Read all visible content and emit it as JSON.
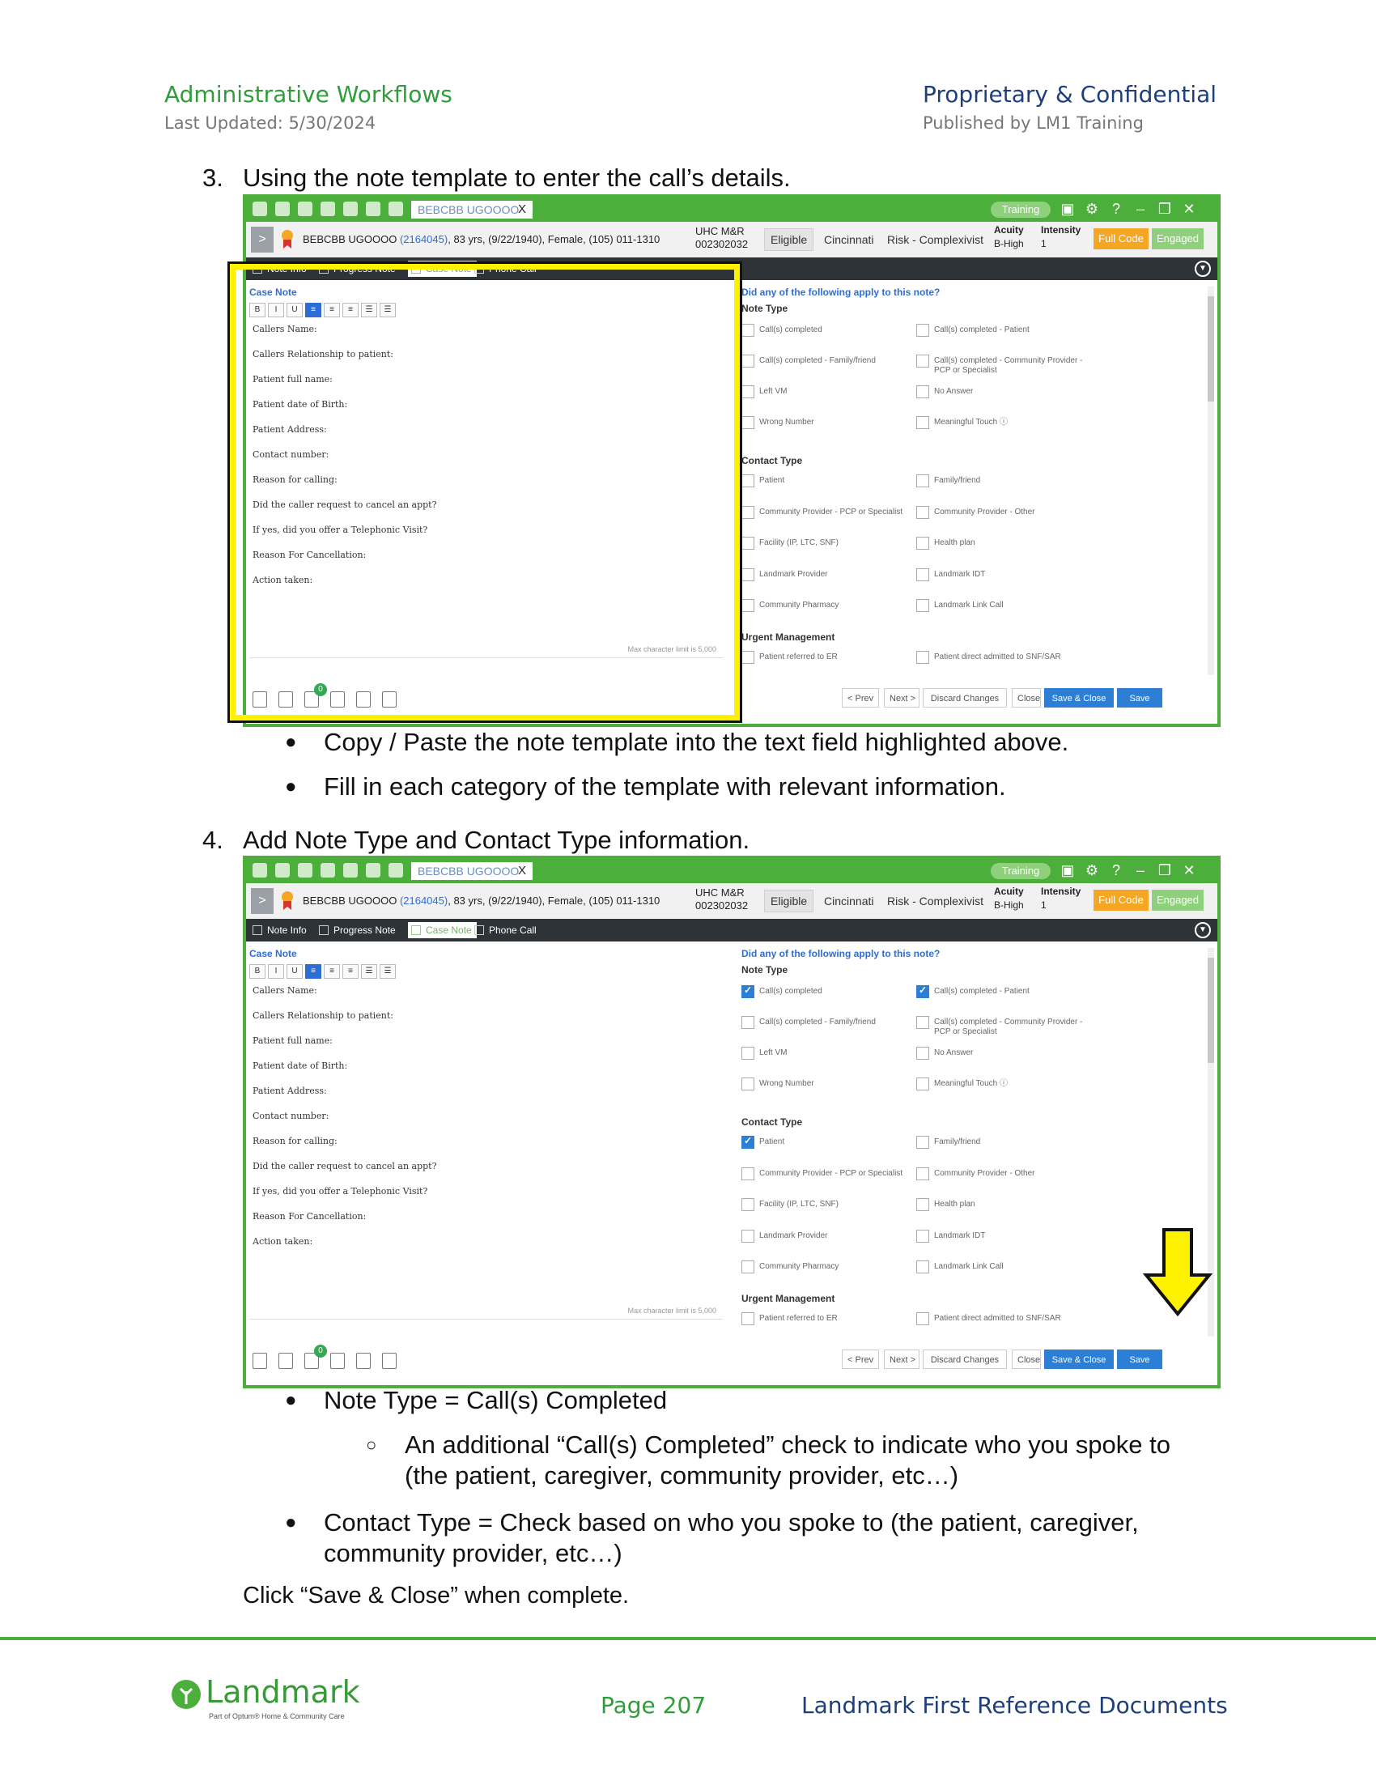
{
  "header": {
    "left_title": "Administrative Workflows",
    "left_sub": "Last Updated: 5/30/2024",
    "right_title": "Proprietary & Confidential",
    "right_sub": "Published by LM1 Training"
  },
  "step3": {
    "num": "3.",
    "text": "Using the note template to enter the call’s details.",
    "bullets": [
      "Copy / Paste the note template into the text field highlighted above.",
      "Fill in each category of the template with relevant information."
    ]
  },
  "step4": {
    "num": "4.",
    "text": "Add Note Type and Contact Type information.",
    "bullet1": "Note Type = Call(s) Completed",
    "sub_bullet": "An additional “Call(s) Completed” check to indicate who you spoke to (the patient, caregiver, community provider, etc…)",
    "bullet2": "Contact Type = Check based on who you spoke to (the patient,  caregiver, community provider, etc…)",
    "closing": "Click “Save & Close” when complete."
  },
  "app": {
    "tab_label": "BEBCBB UGOOOO",
    "tab_close": "X",
    "training": "Training",
    "patient_name": "BEBCBB UGOOOO",
    "patient_id": "(2164045)",
    "patient_info": ", 83 yrs, (9/22/1940), Female, (105) 011-1310",
    "plan_line1": "UHC M&R",
    "plan_line2": "002302032",
    "eligible": "Eligible",
    "city": "Cincinnati",
    "risk": "Risk - Complexivist",
    "acuity_label": "Acuity",
    "acuity_value": "B-High",
    "intensity_label": "Intensity",
    "intensity_value": "1",
    "full_code": "Full Code",
    "engaged": "Engaged",
    "nav_tabs": [
      "Note Info",
      "Progress Note",
      "Case Note",
      "Phone Call"
    ],
    "editor_title": "Case Note",
    "toolbar": [
      "B",
      "I",
      "U",
      "≡",
      "≡",
      "≡",
      "☰",
      "☰"
    ],
    "template_lines": [
      "Callers Name:",
      "Callers Relationship to patient:",
      "Patient full name:",
      "Patient date of Birth:",
      "Patient Address:",
      "Contact number:",
      "Reason for calling:",
      "Did the caller request to cancel an appt?",
      "If yes, did you offer a Telephonic Visit?",
      "Reason For Cancellation:",
      "Action taken:"
    ],
    "max_chars": "Max character limit is 5,000",
    "question": "Did any of the following apply to this note?",
    "note_type_label": "Note Type",
    "note_types": [
      "Call(s) completed",
      "Call(s) completed - Patient",
      "Call(s) completed - Family/friend",
      "Call(s) completed - Community Provider - PCP or Specialist",
      "Left VM",
      "No Answer",
      "Wrong Number",
      "Meaningful Touch ⓘ"
    ],
    "contact_type_label": "Contact Type",
    "contact_types": [
      "Patient",
      "Family/friend",
      "Community Provider - PCP or Specialist",
      "Community Provider - Other",
      "Facility (IP, LTC, SNF)",
      "Health plan",
      "Landmark Provider",
      "Landmark IDT",
      "Community Pharmacy",
      "Landmark Link Call"
    ],
    "urgent_label": "Urgent Management",
    "urgent": [
      "Patient referred to ER",
      "Patient direct admitted to SNF/SAR"
    ],
    "badge": "0",
    "buttons": [
      "< Prev",
      "Next >",
      "Discard Changes",
      "Close",
      "Save & Close",
      "Save"
    ]
  },
  "footer": {
    "logo": "Landmark",
    "logo_sub": "Part of Optum® Home & Community Care",
    "page": "Page 207",
    "doc": "Landmark First Reference Documents"
  }
}
